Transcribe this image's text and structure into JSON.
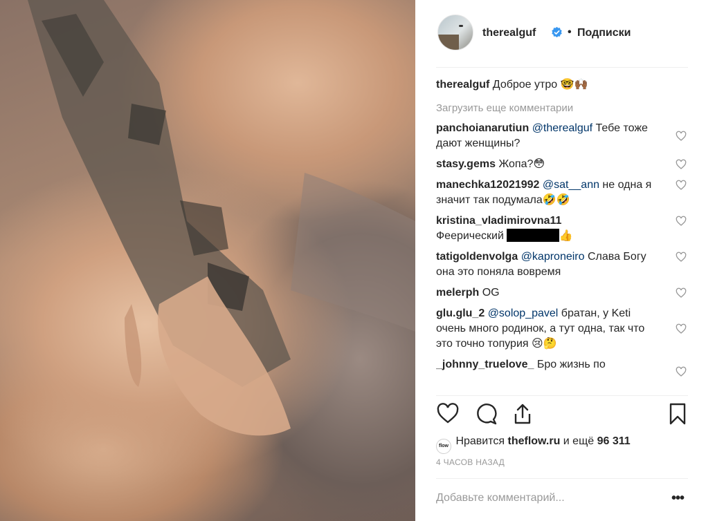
{
  "post": {
    "username": "therealguf",
    "follow_status": "Подписки",
    "separator": "•",
    "caption_user": "therealguf",
    "caption_text": "Доброе утро 🤓🙌🏾"
  },
  "load_more_label": "Загрузить еще комментарии",
  "comments": [
    {
      "user": "panchoianarutiun",
      "mention": "@therealguf",
      "text": " Тебе тоже дают женщины?"
    },
    {
      "user": "stasy.gems",
      "mention": "",
      "text": "Жопа?😳"
    },
    {
      "user": "manechka12021992",
      "mention": "@sat__ann",
      "text": " не одна я значит так подумала🤣🤣"
    },
    {
      "user": "kristina_vladimirovna11",
      "mention": "",
      "text": "Феерический",
      "suffix": "👍"
    },
    {
      "user": "tatigoldenvolga",
      "mention": "@kaproneiro",
      "text": " Слава Богу она это поняла вовремя"
    },
    {
      "user": "melerph",
      "mention": "",
      "text": "OG"
    },
    {
      "user": "glu.glu_2",
      "mention": "@solop_pavel",
      "text": " братан, у Keti очень много родинок, а тут одна, так что это точно топурия 😢🤔"
    },
    {
      "user": "_johnny_truelove_",
      "mention": "",
      "text": "Бро жизнь по"
    }
  ],
  "likes": {
    "avatar_label": "flow",
    "prefix": "Нравится ",
    "user": "theflow.ru",
    "middle": " и ещё ",
    "count": "96 311"
  },
  "timestamp": "4 часов назад",
  "add_comment_placeholder": "Добавьте комментарий...",
  "more_options": "•••",
  "icons": {
    "verified": "verified-badge-icon",
    "like": "heart-icon",
    "comment": "comment-bubble-icon",
    "share": "share-icon",
    "save": "bookmark-icon",
    "comment_like": "small-heart-icon",
    "more": "more-options-icon"
  },
  "colors": {
    "verified_blue": "#3897f0",
    "mention_blue": "#003569",
    "muted_gray": "#999999",
    "text_dark": "#262626"
  }
}
